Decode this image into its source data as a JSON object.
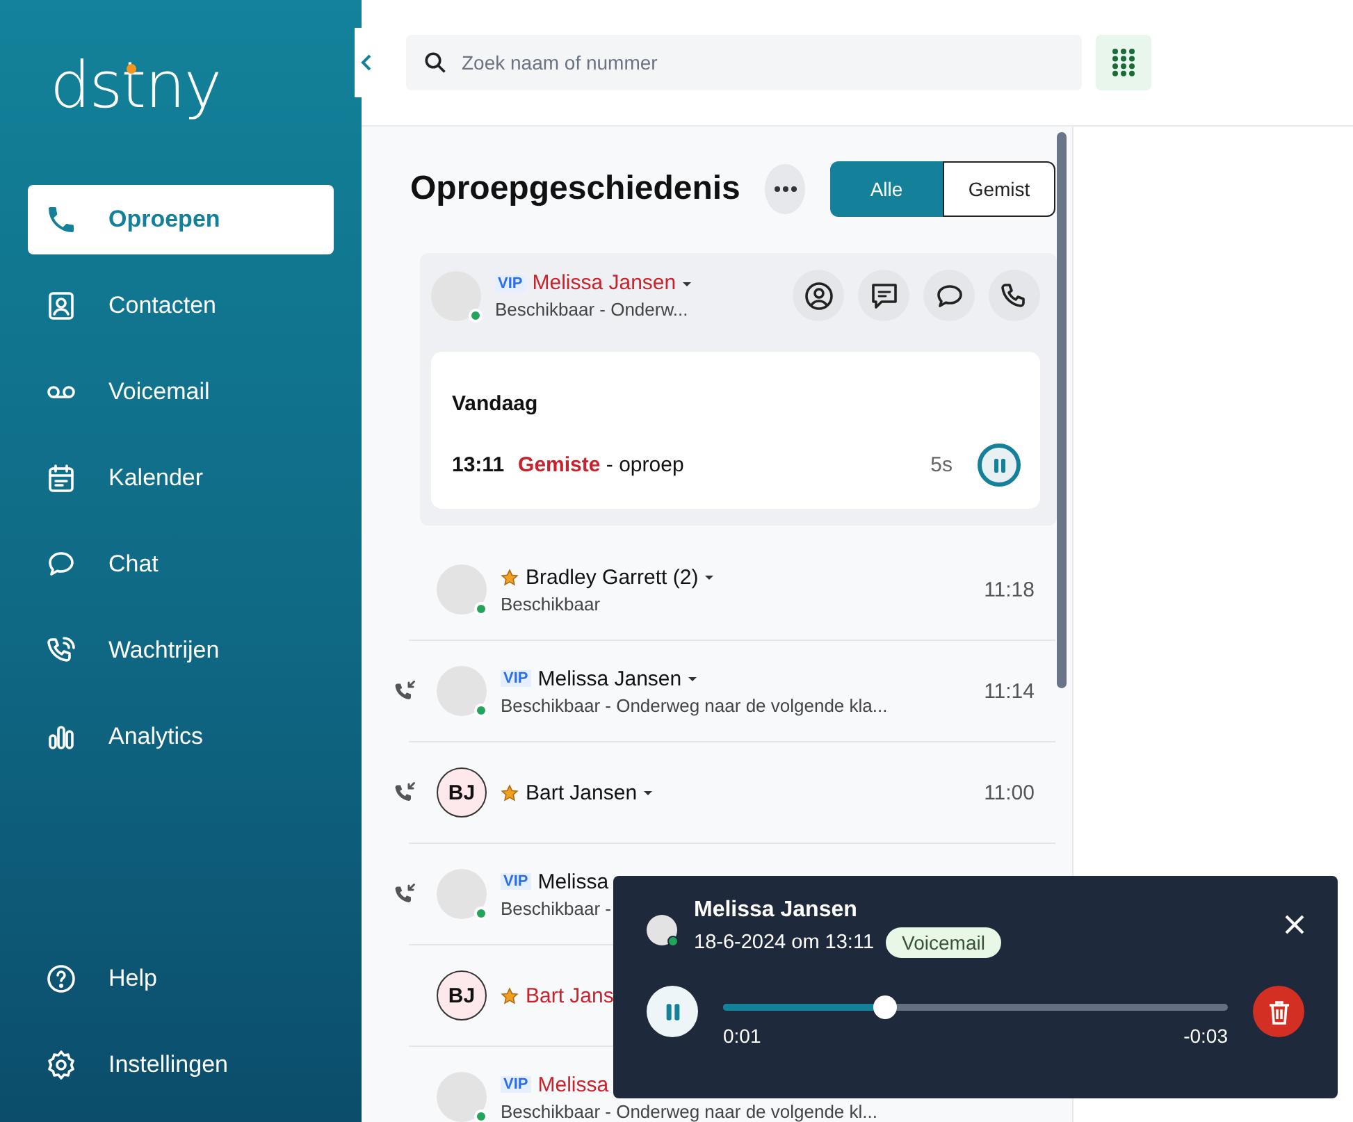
{
  "sidebar": {
    "logo": "dstny",
    "items": [
      {
        "label": "Oproepen",
        "selected": true
      },
      {
        "label": "Contacten",
        "selected": false
      },
      {
        "label": "Voicemail",
        "selected": false
      },
      {
        "label": "Kalender",
        "selected": false
      },
      {
        "label": "Chat",
        "selected": false
      },
      {
        "label": "Wachtrijen",
        "selected": false
      },
      {
        "label": "Analytics",
        "selected": false
      }
    ],
    "bottom_items": [
      {
        "label": "Help"
      },
      {
        "label": "Instellingen"
      }
    ]
  },
  "search": {
    "placeholder": "Zoek naam of nummer"
  },
  "history": {
    "title": "Oproepgeschiedenis",
    "filters": [
      {
        "label": "Alle",
        "selected": true
      },
      {
        "label": "Gemist",
        "selected": false
      }
    ],
    "expanded": {
      "badge": "VIP",
      "name": "Melissa Jansen",
      "missed": true,
      "status": "Beschikbaar - Onderw...",
      "online": true,
      "day": "Vandaag",
      "time": "13:11",
      "result": "Gemiste",
      "result_rest": "- oproep",
      "duration": "5s",
      "playing": true
    },
    "rows": [
      {
        "incoming": false,
        "online": true,
        "starred": true,
        "name": "Bradley Garrett (2)",
        "missed": false,
        "caret": true,
        "status": "Beschikbaar",
        "time": "11:18"
      },
      {
        "incoming": true,
        "online": true,
        "starred": false,
        "badge": "VIP",
        "name": "Melissa Jansen",
        "missed": false,
        "caret": true,
        "status": "Beschikbaar - Onderweg naar de volgende kla...",
        "time": "11:14"
      },
      {
        "incoming": true,
        "initials": "BJ",
        "online": false,
        "starred": true,
        "name": "Bart Jansen",
        "missed": false,
        "caret": true,
        "time": "11:00"
      },
      {
        "incoming": true,
        "online": true,
        "starred": false,
        "badge": "VIP",
        "name": "Melissa",
        "missed": false,
        "caret": false,
        "status": "Beschikbaar -"
      },
      {
        "incoming": false,
        "initials": "BJ",
        "online": false,
        "starred": true,
        "name": "Bart Jans",
        "missed": true,
        "caret": false
      },
      {
        "incoming": false,
        "online": true,
        "starred": false,
        "badge": "VIP",
        "name": "Melissa",
        "missed": true,
        "caret": false,
        "status": "Beschikbaar - Onderweg naar de volgende kl..."
      }
    ]
  },
  "player": {
    "name": "Melissa Jansen",
    "online": true,
    "date": "18-6-2024 om 13:11",
    "tag": "Voicemail",
    "playing": true,
    "level": 0.32,
    "elapsed": "0:01",
    "remaining": "-0:03"
  }
}
